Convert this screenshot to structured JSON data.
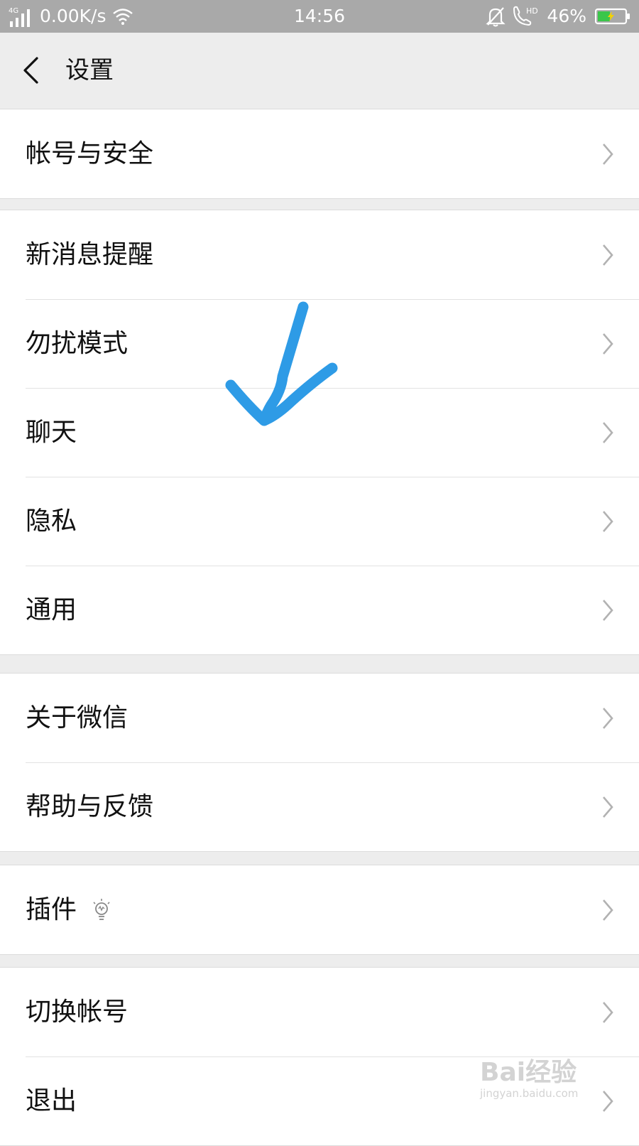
{
  "status_bar": {
    "network_type": "4G",
    "speed": "0.00K/s",
    "time": "14:56",
    "hd_label": "HD",
    "battery": "46%",
    "battery_level": 0.46,
    "icons": [
      "signal-icon",
      "wifi-icon",
      "mute-bell-icon",
      "hd-call-icon",
      "battery-icon"
    ]
  },
  "header": {
    "back_icon": "chevron-left-icon",
    "title": "设置"
  },
  "groups": [
    {
      "items": [
        {
          "label": "帐号与安全"
        }
      ]
    },
    {
      "items": [
        {
          "label": "新消息提醒"
        },
        {
          "label": "勿扰模式"
        },
        {
          "label": "聊天"
        },
        {
          "label": "隐私"
        },
        {
          "label": "通用"
        }
      ]
    },
    {
      "items": [
        {
          "label": "关于微信"
        },
        {
          "label": "帮助与反馈"
        }
      ]
    },
    {
      "items": [
        {
          "label": "插件",
          "icon": "lightbulb-icon"
        }
      ]
    },
    {
      "items": [
        {
          "label": "切换帐号"
        },
        {
          "label": "退出"
        }
      ]
    }
  ],
  "annotation": {
    "type": "hand-drawn arrow",
    "color": "#2e9be6"
  },
  "watermark": {
    "text": "Bai经验",
    "url": "jingyan.baidu.com"
  },
  "colors": {
    "status_bar": "#a9a9a9",
    "background": "#ededed",
    "row": "#ffffff",
    "text": "#111111",
    "chevron": "#b2b2b2"
  }
}
